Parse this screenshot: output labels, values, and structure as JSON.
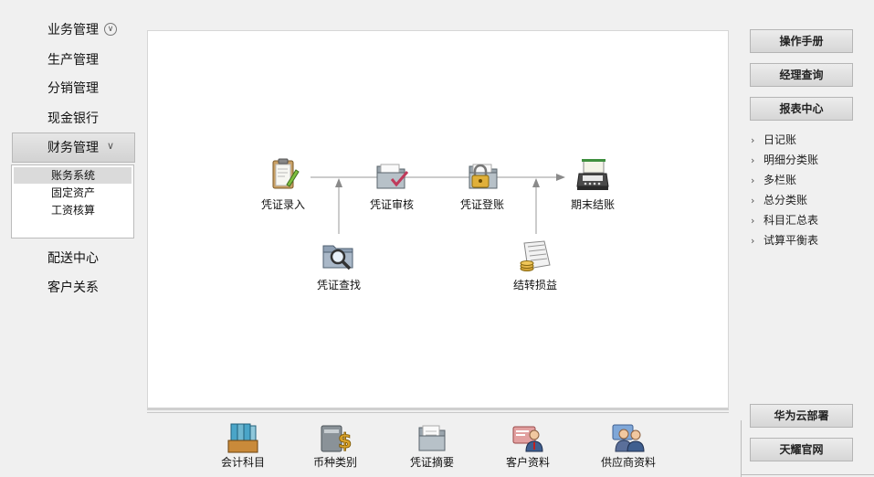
{
  "nav": {
    "items": [
      {
        "label": "业务管理"
      },
      {
        "label": "生产管理"
      },
      {
        "label": "分销管理"
      },
      {
        "label": "现金银行"
      },
      {
        "label": "财务管理"
      },
      {
        "label": "配送中心"
      },
      {
        "label": "客户关系"
      }
    ],
    "finance_sub": [
      {
        "label": "账务系统",
        "selected": true
      },
      {
        "label": "固定资产"
      },
      {
        "label": "工资核算"
      }
    ]
  },
  "workflow": {
    "voucher_entry": "凭证录入",
    "voucher_review": "凭证审核",
    "voucher_post": "凭证登账",
    "period_close": "期末结账",
    "voucher_search": "凭证查找",
    "profit_transfer": "结转损益"
  },
  "shortcuts": [
    {
      "label": "会计科目"
    },
    {
      "label": "币种类别"
    },
    {
      "label": "凭证摘要"
    },
    {
      "label": "客户资料"
    },
    {
      "label": "供应商资料"
    }
  ],
  "right": {
    "manual": "操作手册",
    "manager_query": "经理查询",
    "report_center": "报表中心",
    "reports": [
      {
        "label": "日记账"
      },
      {
        "label": "明细分类账"
      },
      {
        "label": "多栏账"
      },
      {
        "label": "总分类账"
      },
      {
        "label": "科目汇总表"
      },
      {
        "label": "试算平衡表"
      }
    ],
    "huawei_cloud": "华为云部署",
    "official_site": "天耀官网"
  }
}
